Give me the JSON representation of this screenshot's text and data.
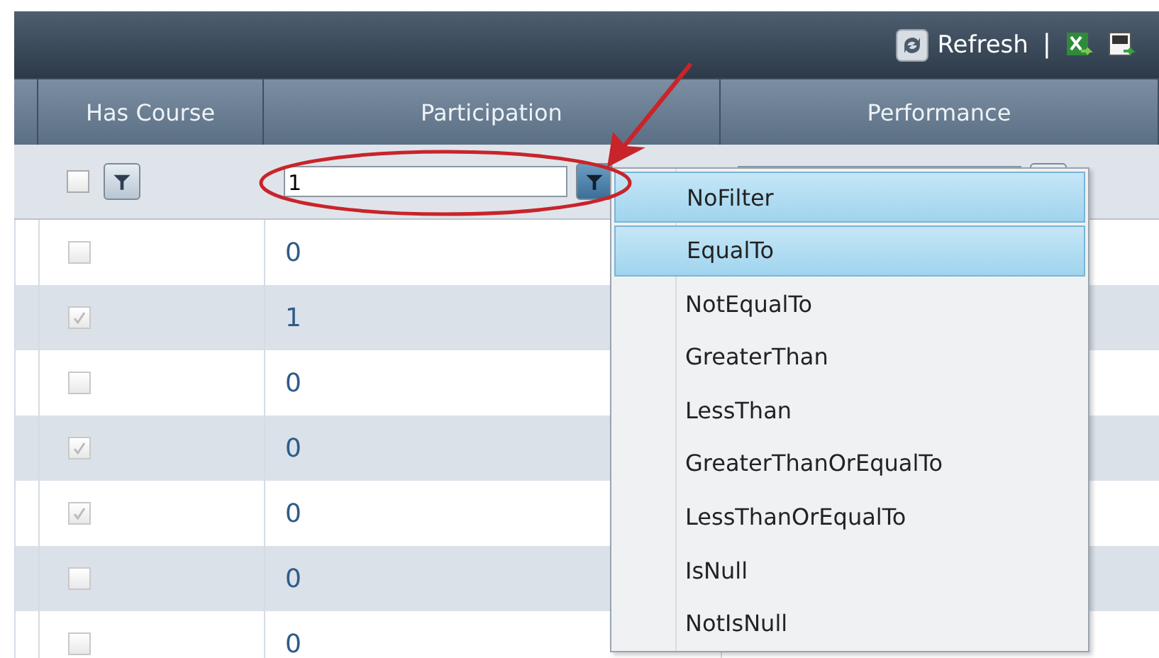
{
  "toolbar": {
    "refresh_label": "Refresh",
    "separator": "|"
  },
  "columns": [
    {
      "label": "Has Course"
    },
    {
      "label": "Participation"
    },
    {
      "label": "Performance"
    }
  ],
  "filter_row": {
    "has_course_checked": false,
    "participation_value": "1"
  },
  "rows": [
    {
      "has_course": false,
      "participation": "0"
    },
    {
      "has_course": true,
      "participation": "1"
    },
    {
      "has_course": false,
      "participation": "0"
    },
    {
      "has_course": true,
      "participation": "0"
    },
    {
      "has_course": true,
      "participation": "0"
    },
    {
      "has_course": false,
      "participation": "0"
    },
    {
      "has_course": false,
      "participation": "0"
    }
  ],
  "filter_menu": [
    {
      "label": "NoFilter",
      "highlighted": true
    },
    {
      "label": "EqualTo",
      "highlighted": true
    },
    {
      "label": "NotEqualTo",
      "highlighted": false
    },
    {
      "label": "GreaterThan",
      "highlighted": false
    },
    {
      "label": "LessThan",
      "highlighted": false
    },
    {
      "label": "GreaterThanOrEqualTo",
      "highlighted": false
    },
    {
      "label": "LessThanOrEqualTo",
      "highlighted": false
    },
    {
      "label": "IsNull",
      "highlighted": false
    },
    {
      "label": "NotIsNull",
      "highlighted": false
    }
  ]
}
